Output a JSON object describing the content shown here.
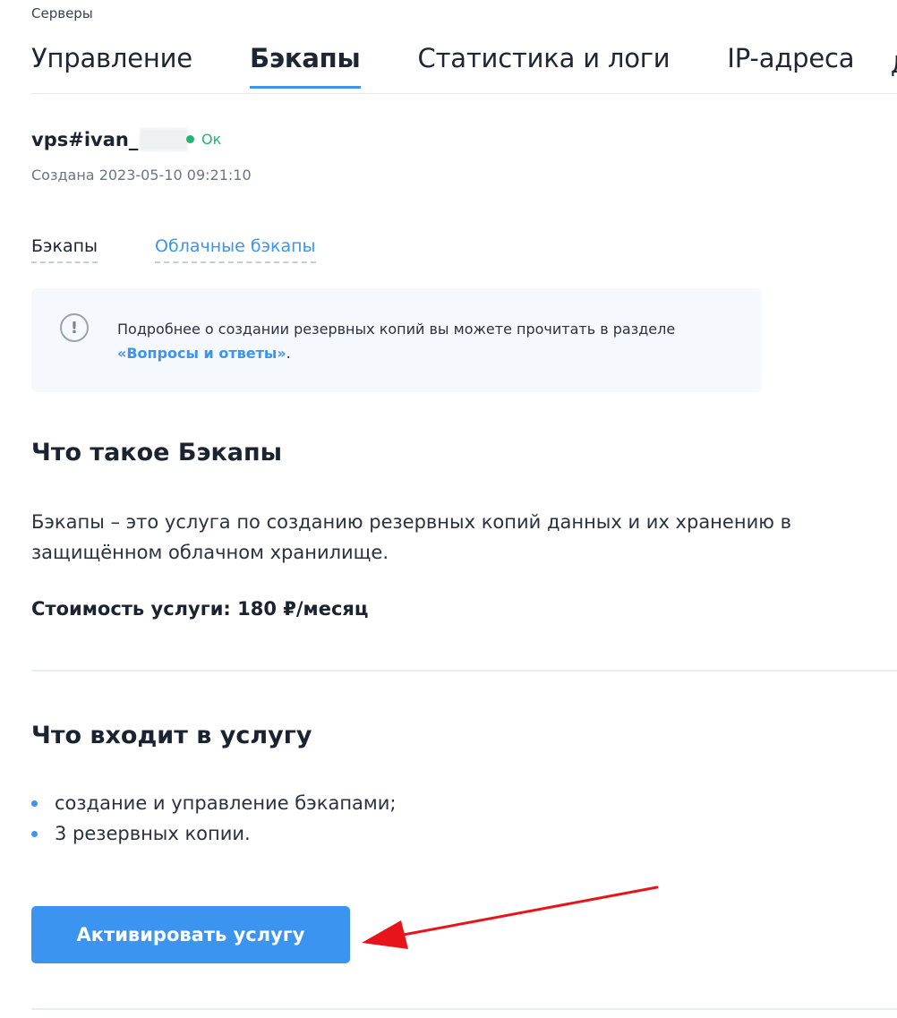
{
  "breadcrumb": "Серверы",
  "tabs": [
    {
      "label": "Управление"
    },
    {
      "label": "Бэкапы"
    },
    {
      "label": "Статистика и логи"
    },
    {
      "label": "IP-адреса"
    }
  ],
  "server": {
    "name": "vps#ivan_",
    "status": "Ок",
    "created": "Создана 2023-05-10 09:21:10"
  },
  "subtabs": [
    {
      "label": "Бэкапы"
    },
    {
      "label": "Облачные бэкапы"
    }
  ],
  "info": {
    "text": "Подробнее о создании резервных копий вы можете прочитать в разделе",
    "link": "«Вопросы и ответы»",
    "suffix": "."
  },
  "about": {
    "title": "Что такое Бэкапы",
    "description": "Бэкапы – это услуга по созданию резервных копий данных и их хранению в защищённом облачном хранилище.",
    "price": "Стоимость услуги: 180 ₽/месяц"
  },
  "includes": {
    "title": "Что входит в услугу",
    "items": [
      "создание и управление бэкапами;",
      "3 резервных копии."
    ]
  },
  "activate_label": "Активировать услугу",
  "colors": {
    "accent": "#3b95f0",
    "status_ok": "#22b573",
    "annotation": "#e8141b"
  }
}
